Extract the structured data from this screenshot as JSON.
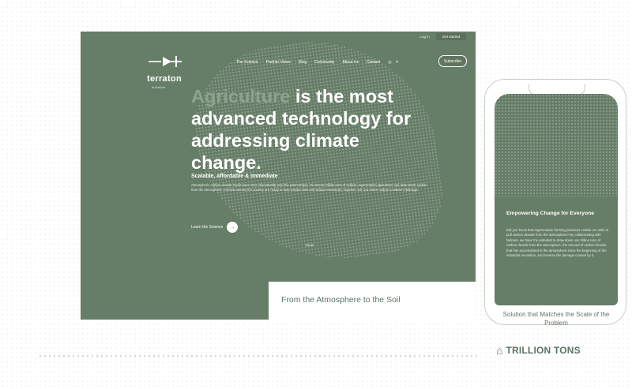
{
  "desktop": {
    "topbar": {
      "link": "Log in",
      "cta": "Get started"
    },
    "logo": {
      "word": "terraton",
      "sub": "initiative"
    },
    "nav": {
      "items": [
        "The Science",
        "Partner Vision",
        "Blog",
        "Community",
        "About Us",
        "Contact"
      ],
      "subscribe": "Subscribe",
      "social": [
        "instagram-icon",
        "twitter-icon"
      ]
    },
    "hero": {
      "headline_soft": "Agriculture",
      "headline_main": " is the most advanced technology for addressing climate change.",
      "subhead": "Scalable, affordable & immediate",
      "body": "Atmospheric carbon dioxide levels have risen dramatically over the past century. To remove trillion tons of carbon, regenerative agriculture can draw down carbon from the atmosphere. Farmers across the country are ready to help restore soils and reduce emissions. Together, we can return carbon to where it belongs.",
      "learn": "Learn the Science",
      "scroll": "Scroll"
    },
    "section": {
      "title": "From the Atmosphere to the Soil"
    }
  },
  "phone": {
    "heading": "Empowering Change for Everyone",
    "body": "Did you know that regenerative farming practices enable our soils to pull carbon dioxide from the atmosphere? By collaborating with farmers, we have the potential to draw down one trillion tons of carbon dioxide from the atmosphere, the amount of carbon dioxide that has accumulated in the atmosphere since the beginning of the industrial revolution, and reverse the damage caused by it.",
    "footer": "Solution that Matches the Scale of the Problem"
  },
  "brand": {
    "text": "TRILLION TONS"
  },
  "colors": {
    "sage": "#667d67",
    "soft_green": "#8ca48b",
    "text_green": "#5b7560"
  }
}
